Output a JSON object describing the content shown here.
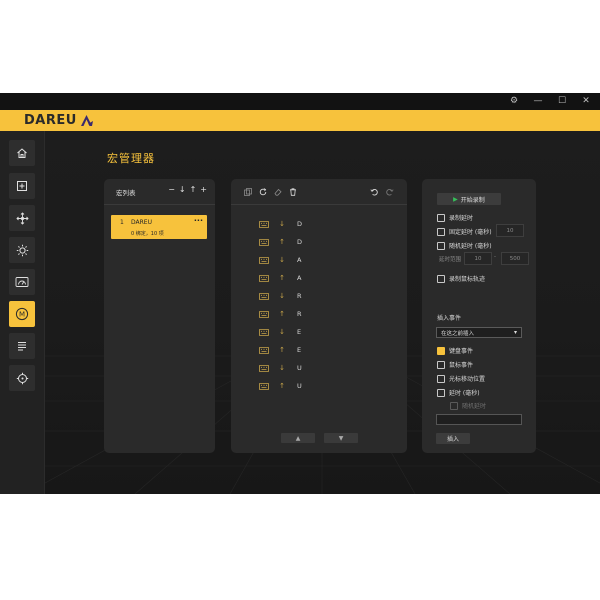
{
  "window": {
    "controls": [
      {
        "name": "settings",
        "glyph": "⚙"
      },
      {
        "name": "minimize",
        "glyph": "—"
      },
      {
        "name": "maximize",
        "glyph": "☐"
      },
      {
        "name": "close",
        "glyph": "✕"
      }
    ]
  },
  "brand": {
    "logo_text": "DAREU",
    "accent": "#f7c23c"
  },
  "sidebar": {
    "items": [
      {
        "name": "home",
        "icon": "home-icon",
        "active": false
      },
      {
        "name": "add",
        "icon": "plus-square-icon",
        "active": false
      },
      {
        "name": "move",
        "icon": "move-arrows-icon",
        "active": false
      },
      {
        "name": "lighting",
        "icon": "sun-icon",
        "active": false
      },
      {
        "name": "performance",
        "icon": "speedometer-icon",
        "active": false
      },
      {
        "name": "macro",
        "icon": "macro-m-icon",
        "active": true,
        "glyph": "M"
      },
      {
        "name": "list",
        "icon": "list-icon",
        "active": false
      },
      {
        "name": "target",
        "icon": "crosshair-icon",
        "active": false
      }
    ]
  },
  "page": {
    "title": "宏管理器"
  },
  "macro_list": {
    "title": "宏列表",
    "tools": [
      "−",
      "↓",
      "↑",
      "+"
    ],
    "items": [
      {
        "index": "1",
        "name": "DAREU",
        "meta": "0 绑定，10 项",
        "menu": "···"
      }
    ]
  },
  "events": {
    "rows": [
      {
        "dir": "↓",
        "key": "D"
      },
      {
        "dir": "↑",
        "key": "D"
      },
      {
        "dir": "↓",
        "key": "A"
      },
      {
        "dir": "↑",
        "key": "A"
      },
      {
        "dir": "↓",
        "key": "R"
      },
      {
        "dir": "↑",
        "key": "R"
      },
      {
        "dir": "↓",
        "key": "E"
      },
      {
        "dir": "↑",
        "key": "E"
      },
      {
        "dir": "↓",
        "key": "U"
      },
      {
        "dir": "↑",
        "key": "U"
      }
    ],
    "nav_up": "▲",
    "nav_down": "▼"
  },
  "recorder": {
    "record_label": "开始录制",
    "record_delay": "录制延时",
    "fixed_delay": "固定延时 (毫秒)",
    "fixed_delay_value": "10",
    "random_delay": "随机延时 (毫秒)",
    "delay_range_label": "延时范围",
    "range_min": "10",
    "range_sep": "-",
    "range_max": "500",
    "record_mouse_track": "录制鼠标轨迹",
    "insert_event_label": "插入事件",
    "insert_position": "在这之前插入",
    "select_caret": "▾",
    "insert_options": [
      {
        "label": "键盘事件",
        "checked": true
      },
      {
        "label": "鼠标事件",
        "checked": false
      },
      {
        "label": "光标移动位置",
        "checked": false
      },
      {
        "label": "延时 (毫秒)",
        "checked": false
      }
    ],
    "sub_random_delay": "随机延时",
    "insert_button": "插入"
  }
}
